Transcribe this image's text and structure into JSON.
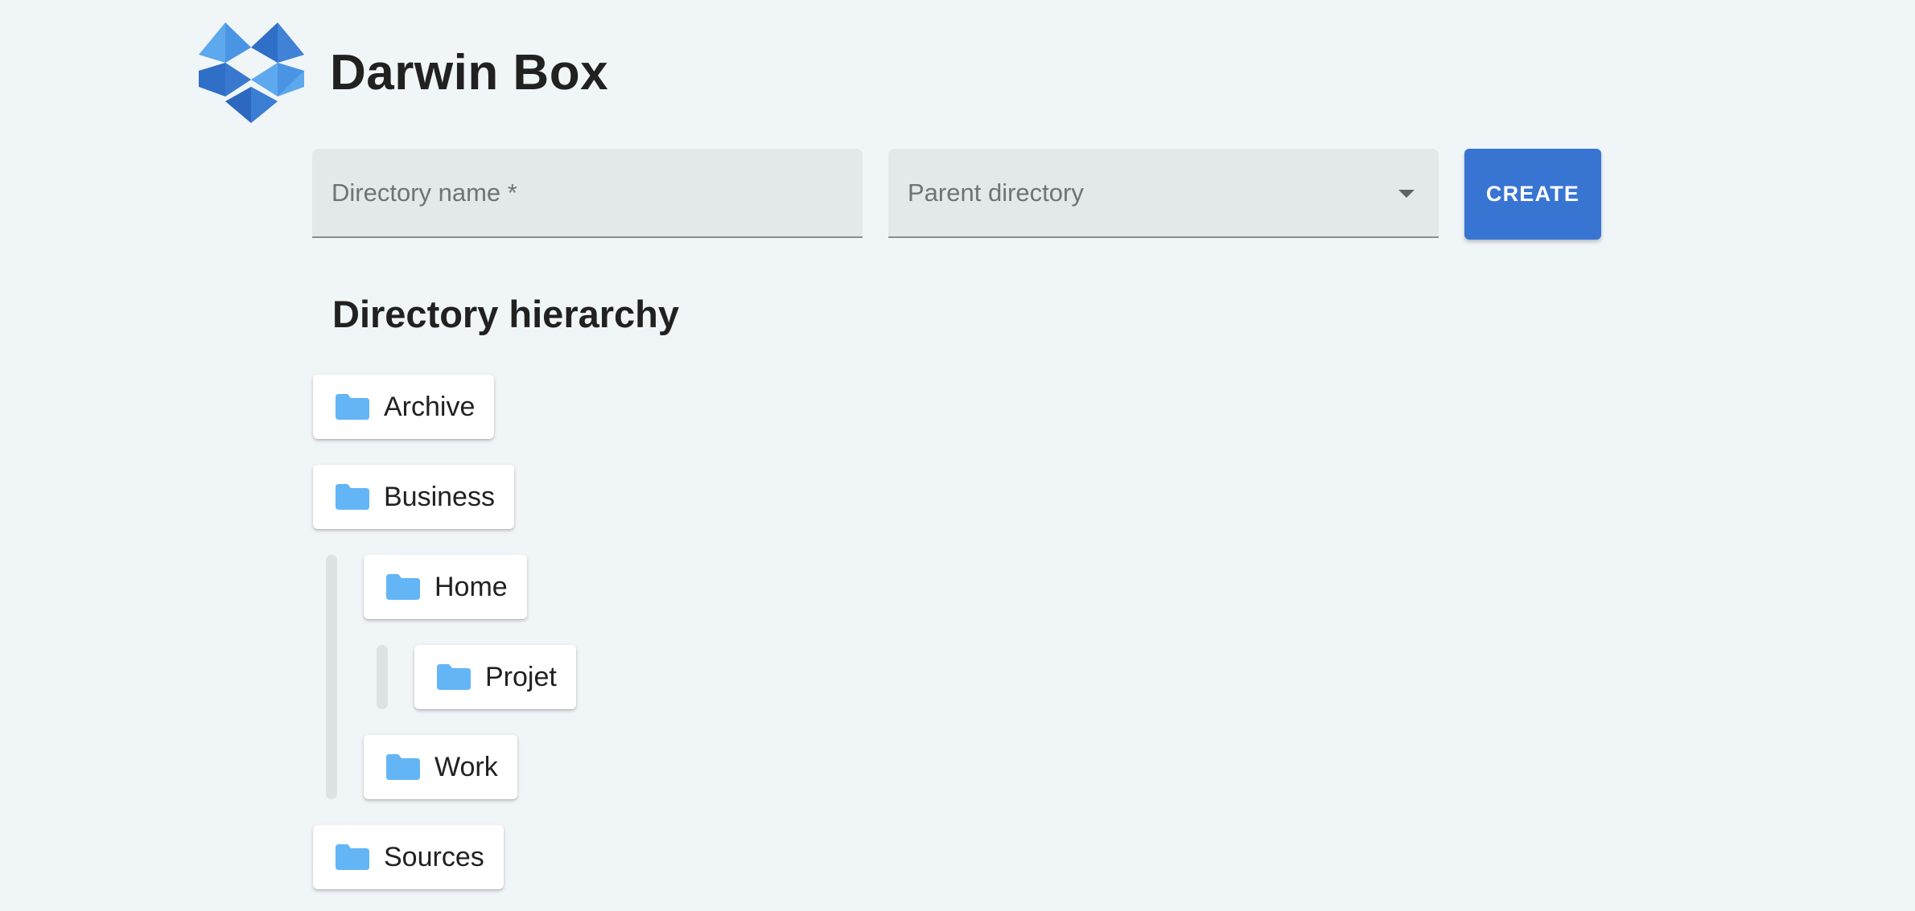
{
  "app": {
    "title": "Darwin Box"
  },
  "form": {
    "directory_name_placeholder": "Directory name *",
    "directory_name_value": "",
    "parent_directory_label": "Parent directory",
    "create_label": "CREATE"
  },
  "hierarchy": {
    "title": "Directory hierarchy",
    "items": [
      {
        "label": "Archive",
        "depth": 0
      },
      {
        "label": "Business",
        "depth": 0
      },
      {
        "label": "Home",
        "depth": 1
      },
      {
        "label": "Projet",
        "depth": 2
      },
      {
        "label": "Work",
        "depth": 1
      },
      {
        "label": "Sources",
        "depth": 0
      }
    ]
  },
  "colors": {
    "background": "#f0f5f8",
    "accent": "#3875d3",
    "folder": "#64b5f6",
    "field_bg": "#e3e8eb"
  },
  "icons": {
    "logo": "dropbox-logo",
    "folder": "folder-icon",
    "dropdown": "caret-down-icon"
  }
}
